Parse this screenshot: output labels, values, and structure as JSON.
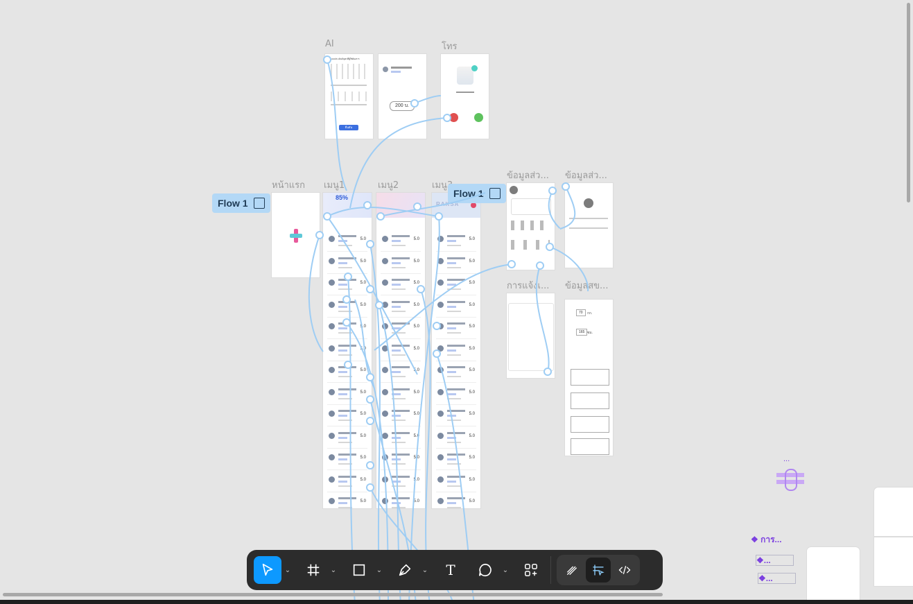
{
  "frames": {
    "ai": "AI",
    "call": "โทร",
    "home": "หน้าแรก",
    "menu1": "เมนู1",
    "menu2": "เมนู2",
    "menu3": "เมนู3",
    "profile1": "ข้อมูลส่ว...",
    "profile2": "ข้อมูลส่ว...",
    "notify": "การแจ้งเ...",
    "health": "ข้อมูลสข..."
  },
  "flows": {
    "flow_a": "Flow 1",
    "flow_b": "Flow 1"
  },
  "screens": {
    "ai_title": "แบบประเมินปัญหาที่ผู้ใช้ต้องการ",
    "ai_button": "ยืนยัน",
    "price": "200 บ.",
    "promo_percent": "85%",
    "promo_brand": "RAKSA",
    "score": "5.0",
    "health_weight": "70",
    "health_height": "165",
    "health_unit_kg": "กก.",
    "health_unit_cm": "ซม."
  },
  "components": {
    "label": "❖ การ...",
    "dots": "...",
    "stack1": "❖...",
    "stack2": "❖..."
  },
  "toolbar": {
    "move": "move-tool",
    "frame": "frame-tool",
    "shape": "rectangle-tool",
    "pen": "pen-tool",
    "text": "T",
    "comment": "comment-tool",
    "actions": "actions-tool",
    "draw": "draw-mode",
    "design": "design-mode",
    "dev": "dev-mode"
  },
  "colors": {
    "canvas": "#e5e5e5",
    "accent": "#0d99ff",
    "flow_line": "#9ecdf4",
    "component": "#7b3fe0"
  }
}
